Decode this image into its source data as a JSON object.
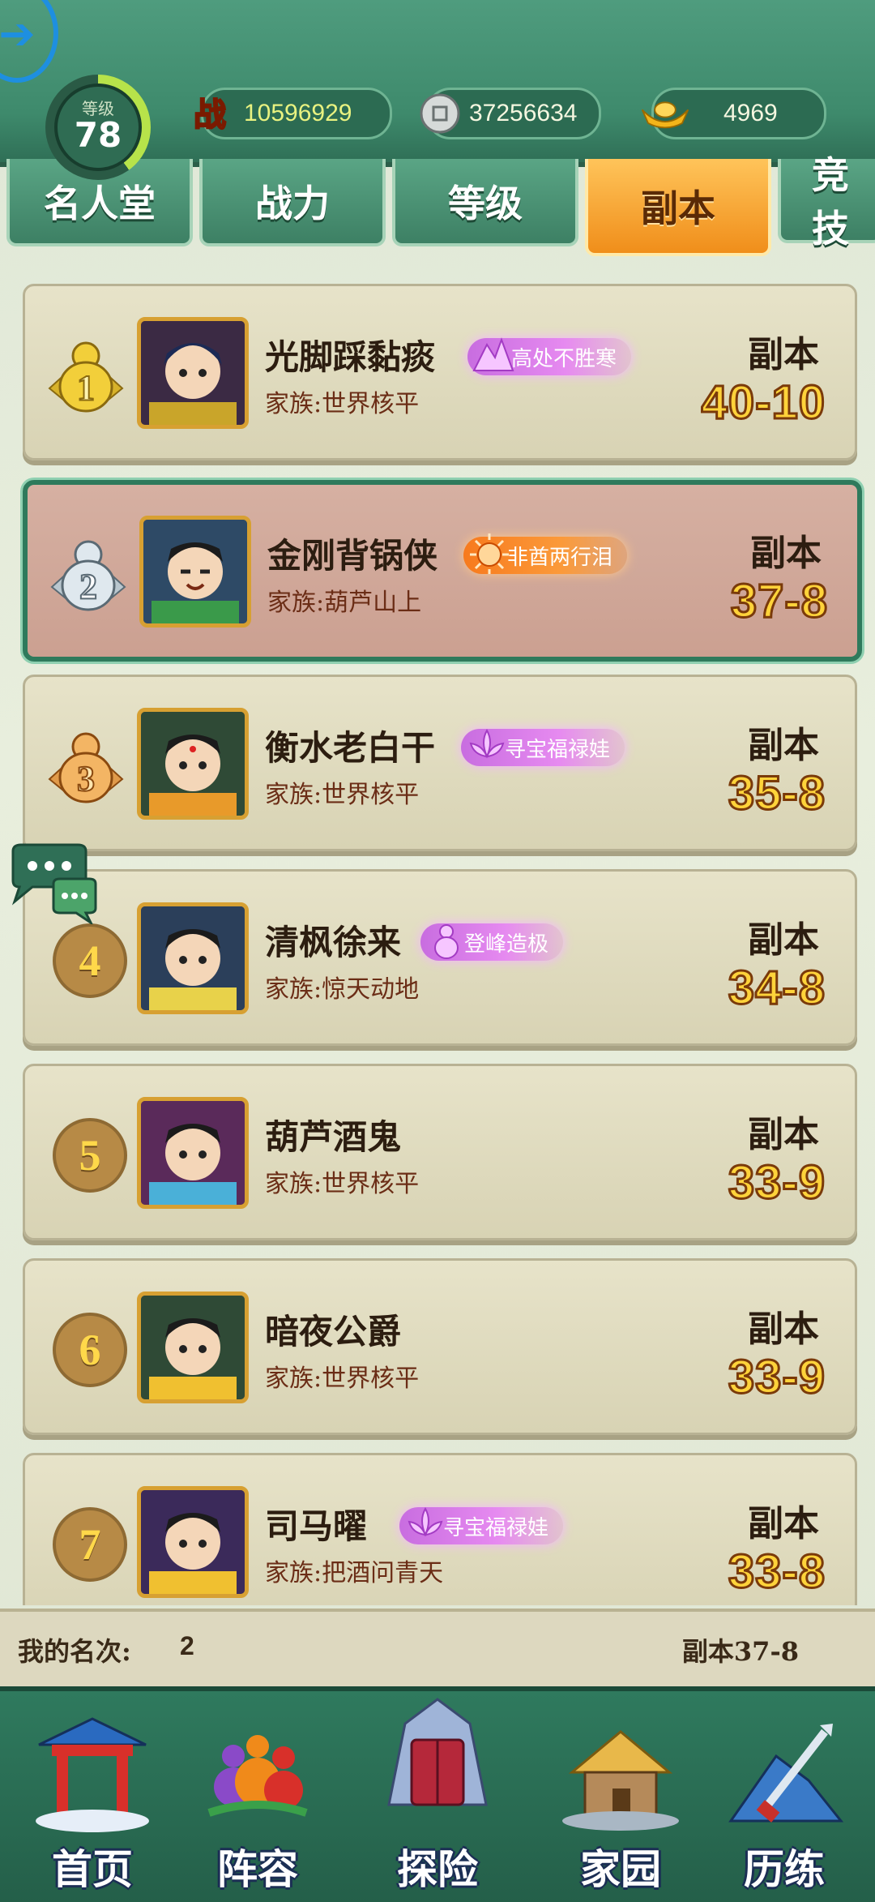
{
  "header": {
    "level_label": "等级",
    "level_value": "78",
    "power_value": "10596929",
    "silver_value": "37256634",
    "gold_value": "4969"
  },
  "tabs": [
    {
      "label": "名人堂",
      "active": false
    },
    {
      "label": "战力",
      "active": false
    },
    {
      "label": "等级",
      "active": false
    },
    {
      "label": "副本",
      "active": true
    },
    {
      "label": "竞技",
      "active": false
    }
  ],
  "list": {
    "dungeon_label": "副本",
    "family_prefix": "家族:",
    "entries": [
      {
        "rank": "1",
        "name": "光脚踩黏痰",
        "title": "高处不胜寒",
        "family": "世界核平",
        "dungeon": "40-10"
      },
      {
        "rank": "2",
        "name": "金刚背锅侠",
        "title": "非酋两行泪",
        "family": "葫芦山上",
        "dungeon": "37-8"
      },
      {
        "rank": "3",
        "name": "衡水老白干",
        "title": "寻宝福禄娃",
        "family": "世界核平",
        "dungeon": "35-8"
      },
      {
        "rank": "4",
        "name": "清枫徐来",
        "title": "登峰造极",
        "family": "惊天动地",
        "dungeon": "34-8"
      },
      {
        "rank": "5",
        "name": "葫芦酒鬼",
        "title": "",
        "family": "世界核平",
        "dungeon": "33-9"
      },
      {
        "rank": "6",
        "name": "暗夜公爵",
        "title": "",
        "family": "世界核平",
        "dungeon": "33-9"
      },
      {
        "rank": "7",
        "name": "司马曜",
        "title": "寻宝福禄娃",
        "family": "把酒问青天",
        "dungeon": "33-8"
      }
    ]
  },
  "my_rank": {
    "label": "我的名次:",
    "value": "2",
    "dungeon": "副本37-8"
  },
  "bottom_nav": [
    {
      "label": "首页",
      "icon": "gate-icon"
    },
    {
      "label": "阵容",
      "icon": "gourds-icon"
    },
    {
      "label": "探险",
      "icon": "crystal-door-icon"
    },
    {
      "label": "家园",
      "icon": "house-icon"
    },
    {
      "label": "历练",
      "icon": "sword-icon"
    }
  ],
  "colors": {
    "accent_green": "#3e8a6c",
    "active_tab": "#f08e1a",
    "dungeon_value": "#ffd33a",
    "highlight_border": "#2e7a5c"
  }
}
